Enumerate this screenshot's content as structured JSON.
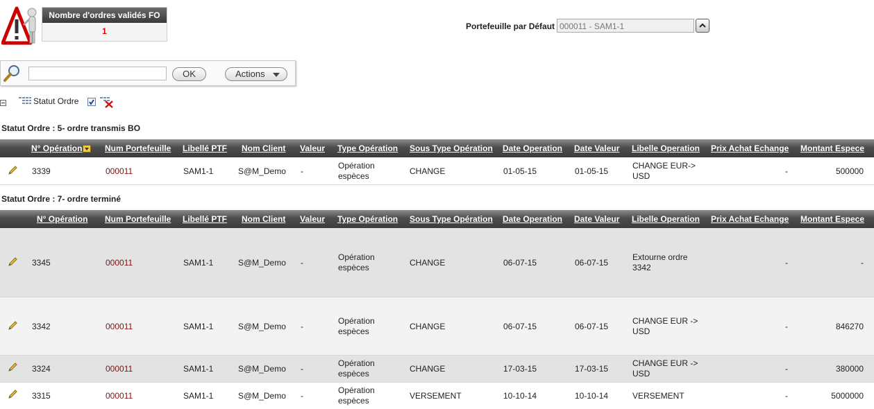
{
  "fo_panel": {
    "title": "Nombre d'ordres validés FO",
    "count": "1"
  },
  "portfolio": {
    "label": "Portefeuille par Défaut",
    "value": "000011  -  SAM1-1"
  },
  "search": {
    "placeholder": "",
    "ok_label": "OK",
    "actions_label": "Actions"
  },
  "grouping": {
    "label": "Statut Ordre"
  },
  "columns": [
    "N° Opération",
    "Num Portefeuille",
    "Libellé PTF",
    "Nom Client",
    "Valeur",
    "Type Opération",
    "Sous Type Opération",
    "Date Operation",
    "Date Valeur",
    "Libelle Operation",
    "Prix Achat Echange",
    "Montant Espece"
  ],
  "groups": [
    {
      "title": "Statut Ordre : 5- ordre transmis BO",
      "rows": [
        {
          "num": "3339",
          "ptf": "000011",
          "lib": "SAM1-1",
          "client": "S@M_Demo",
          "valeur": "-",
          "type1": "Opération",
          "type2": "espèces",
          "sous_type": "CHANGE",
          "date_op": "01-05-15",
          "date_val": "01-05-15",
          "libelle1": "CHANGE EUR->",
          "libelle2": "USD",
          "prix": "-",
          "montant": "500000"
        }
      ]
    },
    {
      "title": "Statut Ordre : 7- ordre terminé",
      "rows": [
        {
          "num": "3345",
          "ptf": "000011",
          "lib": "SAM1-1",
          "client": "S@M_Demo",
          "valeur": "-",
          "type1": "Opération",
          "type2": "espèces",
          "sous_type": "CHANGE",
          "date_op": "06-07-15",
          "date_val": "06-07-15",
          "libelle1": "Extourne ordre",
          "libelle2": "3342",
          "prix": "-",
          "montant": "-"
        },
        {
          "num": "3342",
          "ptf": "000011",
          "lib": "SAM1-1",
          "client": "S@M_Demo",
          "valeur": "-",
          "type1": "Opération",
          "type2": "espèces",
          "sous_type": "CHANGE",
          "date_op": "06-07-15",
          "date_val": "06-07-15",
          "libelle1": "CHANGE EUR ->",
          "libelle2": "USD",
          "prix": "-",
          "montant": "846270"
        },
        {
          "num": "3324",
          "ptf": "000011",
          "lib": "SAM1-1",
          "client": "S@M_Demo",
          "valeur": "-",
          "type1": "Opération",
          "type2": "espèces",
          "sous_type": "CHANGE",
          "date_op": "17-03-15",
          "date_val": "17-03-15",
          "libelle1": "CHANGE EUR ->",
          "libelle2": "USD",
          "prix": "-",
          "montant": "380000"
        },
        {
          "num": "3315",
          "ptf": "000011",
          "lib": "SAM1-1",
          "client": "S@M_Demo",
          "valeur": "-",
          "type1": "Opération",
          "type2": "espèces",
          "sous_type": "VERSEMENT",
          "date_op": "10-10-14",
          "date_val": "10-10-14",
          "libelle1": "VERSEMENT",
          "libelle2": "",
          "prix": "-",
          "montant": "5000000"
        }
      ]
    }
  ]
}
